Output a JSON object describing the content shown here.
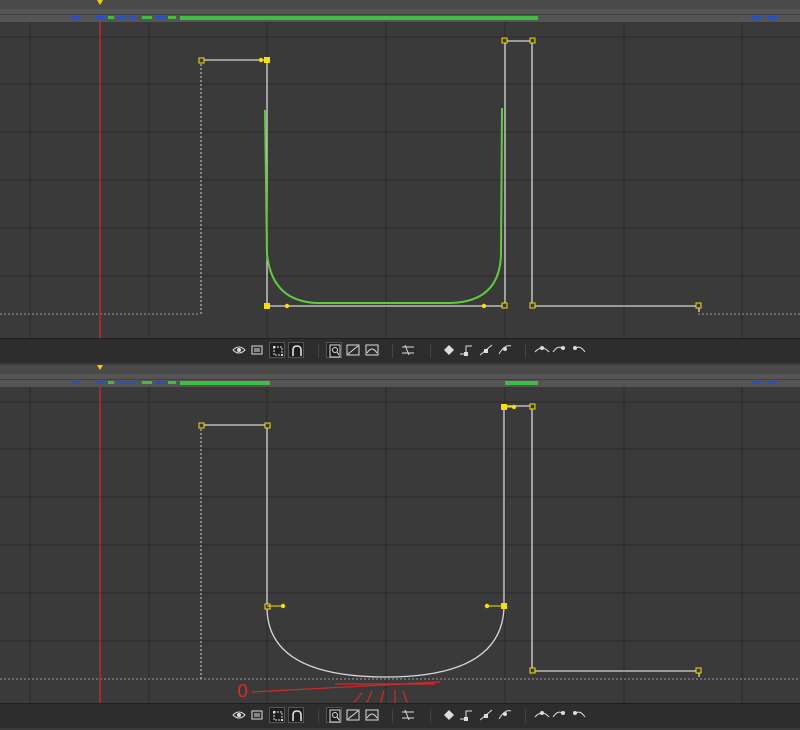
{
  "colors": {
    "background": "#3a3a3a",
    "grid": "#2a2a2a",
    "playhead": "#c0282c",
    "speed_curve": "#5fcc3a",
    "value_path": "#d8d8d8",
    "keyframe": "#f5e000",
    "timebar_green": "#3fbf3f",
    "timebar_blue": "#2a4fc4",
    "annotation": "#d42a2a"
  },
  "top_panel": {
    "curves": [
      "value-graph",
      "speed-graph"
    ]
  },
  "bottom_panel": {
    "curves": [
      "value-graph"
    ],
    "annotation": {
      "text": "0"
    }
  },
  "toolbar": {
    "buttons": [
      {
        "icon": "eye-icon",
        "name": "show-properties-button"
      },
      {
        "icon": "graph-options-icon",
        "name": "graph-options-button"
      },
      {
        "icon": "transform-box-icon",
        "name": "transform-box-button",
        "active": true
      },
      {
        "icon": "snap-icon",
        "name": "snap-button",
        "active": true
      },
      {
        "icon": "auto-zoom-height-icon",
        "name": "auto-zoom-button",
        "active": true
      },
      {
        "icon": "fit-selection-icon",
        "name": "fit-selection-button"
      },
      {
        "icon": "fit-all-icon",
        "name": "fit-all-button"
      },
      {
        "icon": "separate-dimensions-icon",
        "name": "separate-dimensions-button"
      },
      {
        "icon": "edit-keyframe-icon",
        "name": "edit-keyframe-button"
      },
      {
        "icon": "hold-icon",
        "name": "convert-to-hold-button"
      },
      {
        "icon": "linear-icon",
        "name": "convert-to-linear-button"
      },
      {
        "icon": "auto-bezier-icon",
        "name": "convert-to-auto-bezier-button"
      },
      {
        "icon": "easy-ease-icon",
        "name": "easy-ease-button"
      },
      {
        "icon": "easy-ease-in-icon",
        "name": "easy-ease-in-button"
      },
      {
        "icon": "easy-ease-out-icon",
        "name": "easy-ease-out-button"
      }
    ]
  }
}
